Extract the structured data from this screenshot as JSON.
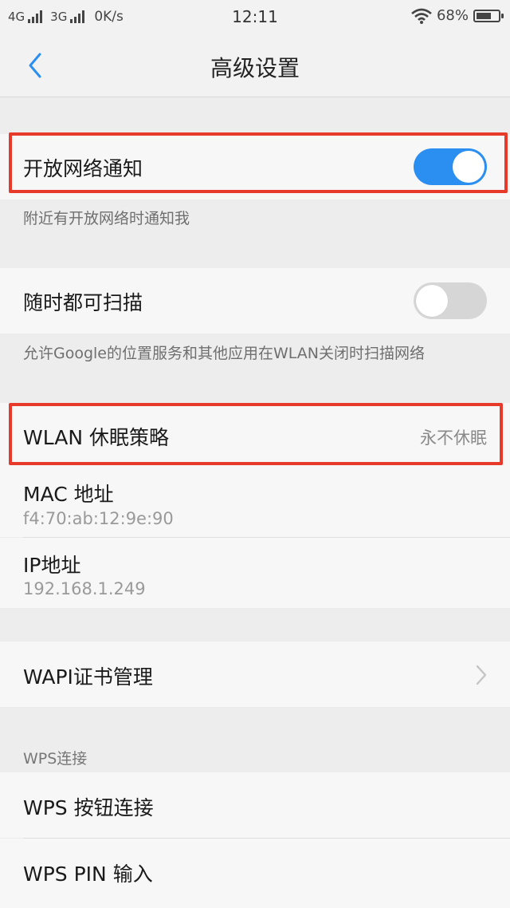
{
  "status_bar": {
    "net1": "4G",
    "net2": "3G",
    "speed": "0K/s",
    "time": "12:11",
    "battery": "68%",
    "battery_level": 0.68
  },
  "nav": {
    "title": "高级设置",
    "back_icon": "chevron-left-icon"
  },
  "settings": {
    "open_network_notify": {
      "label": "开放网络通知",
      "hint": "附近有开放网络时通知我",
      "enabled": true
    },
    "scan_always": {
      "label": "随时都可扫描",
      "hint": "允许Google的位置服务和其他应用在WLAN关闭时扫描网络",
      "enabled": false
    },
    "wlan_sleep": {
      "label": "WLAN 休眠策略",
      "value": "永不休眠"
    },
    "mac": {
      "label": "MAC 地址",
      "value": "f4:70:ab:12:9e:90"
    },
    "ip": {
      "label": "IP地址",
      "value": "192.168.1.249"
    },
    "wapi": {
      "label": "WAPI证书管理"
    },
    "wps_section": "WPS连接",
    "wps_button": {
      "label": "WPS 按钮连接"
    },
    "wps_pin": {
      "label": "WPS PIN 输入"
    }
  },
  "colors": {
    "accent": "#2b8ff2",
    "highlight": "#e83a2a",
    "background": "#ededed"
  }
}
